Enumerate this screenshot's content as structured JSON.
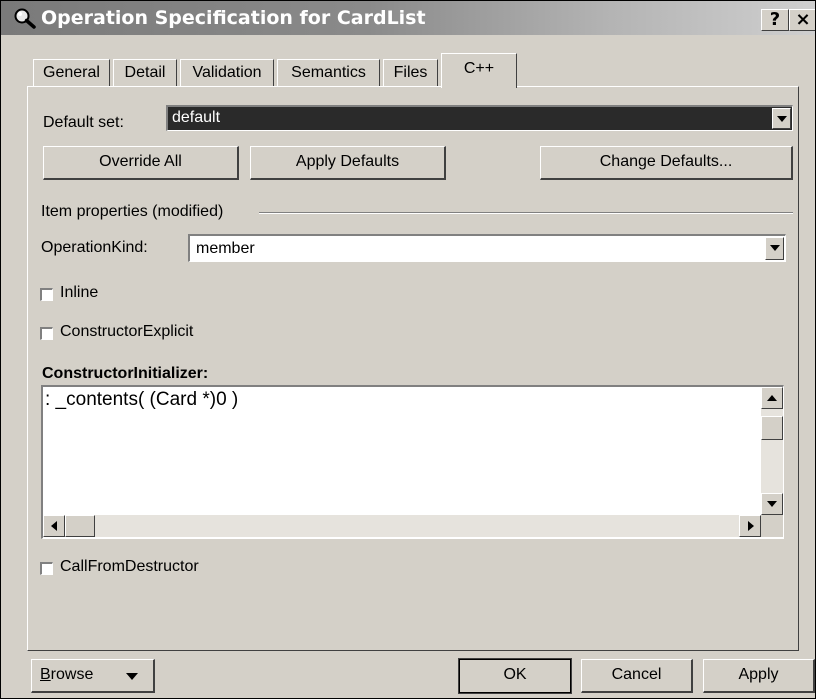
{
  "window": {
    "title": "Operation Specification for CardList",
    "help_label": "?",
    "close_label": "×"
  },
  "tabs": [
    {
      "label": "General",
      "active": false
    },
    {
      "label": "Detail",
      "active": false
    },
    {
      "label": "Validation",
      "active": false
    },
    {
      "label": "Semantics",
      "active": false
    },
    {
      "label": "Files",
      "active": false
    },
    {
      "label": "C++",
      "active": true
    }
  ],
  "default_set": {
    "label": "Default set:",
    "value": "default"
  },
  "buttons": {
    "override_all": "Override All",
    "apply_defaults": "Apply Defaults",
    "change_defaults": "Change Defaults..."
  },
  "item_properties": {
    "group_label": "Item properties (modified)",
    "operation_kind_label": "OperationKind:",
    "operation_kind_value": "member",
    "inline_label": "Inline",
    "inline_checked": false,
    "constructor_explicit_label": "ConstructorExplicit",
    "constructor_explicit_checked": false,
    "constructor_initializer_label": "ConstructorInitializer:",
    "constructor_initializer_value": ": _contents( (Card *)0 )",
    "call_from_destructor_label": "CallFromDestructor",
    "call_from_destructor_checked": false
  },
  "footer": {
    "browse_first": "B",
    "browse_rest": "rowse",
    "ok": "OK",
    "cancel": "Cancel",
    "apply": "Apply"
  },
  "colors": {
    "dialog_bg": "#d4d0c8",
    "titlebar": "#7a7a7a",
    "selected_combo_bg": "#2a2a2a"
  }
}
